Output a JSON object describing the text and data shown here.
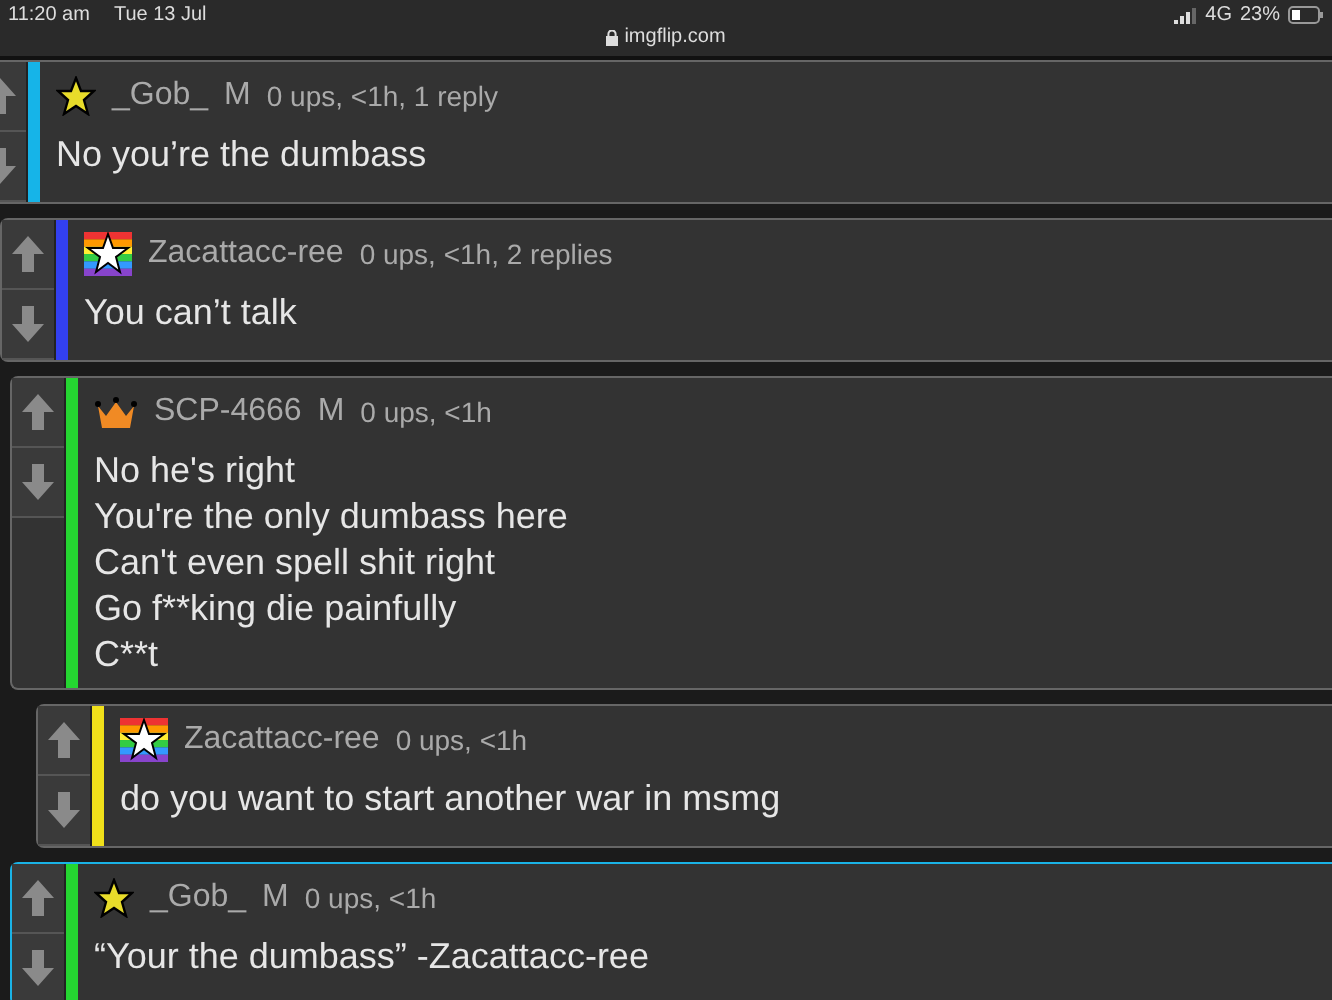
{
  "status_bar": {
    "time": "11:20 am",
    "date": "Tue 13 Jul",
    "url": "imgflip.com",
    "network": "4G",
    "battery": "23%"
  },
  "comments": [
    {
      "kind": "star",
      "color": "#16b4e8",
      "user": "_Gob_",
      "mod": "M",
      "meta": "0 ups, <1h, 1 reply",
      "lines": [
        "No you’re the dumbass"
      ],
      "highlighted": false,
      "children": [
        {
          "kind": "flag",
          "color": "#3340f0",
          "user": "Zacattacc-ree",
          "meta": "0 ups, <1h, 2 replies",
          "lines": [
            "You can’t talk"
          ],
          "highlighted": false,
          "children": [
            {
              "kind": "crown",
              "color": "#25d631",
              "user": "SCP-4666",
              "mod": "M",
              "meta": "0 ups, <1h",
              "lines": [
                "No he's right",
                "You're the only dumbass here",
                "Can't even spell shit right",
                "Go f**king die painfully",
                "C**t"
              ],
              "highlighted": false,
              "children": [
                {
                  "kind": "flag",
                  "color": "#f0e01a",
                  "user": "Zacattacc-ree",
                  "meta": "0 ups, <1h",
                  "lines": [
                    "do you want to start another war in msmg"
                  ],
                  "highlighted": false
                }
              ]
            },
            {
              "kind": "star",
              "color": "#25d631",
              "user": "_Gob_",
              "mod": "M",
              "meta": "0 ups, <1h",
              "lines": [
                "“Your the dumbass” -Zacattacc-ree"
              ],
              "highlighted": true
            }
          ]
        }
      ]
    }
  ]
}
